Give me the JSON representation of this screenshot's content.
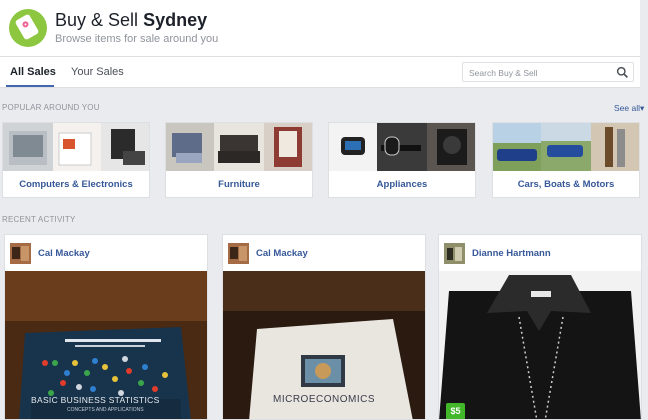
{
  "app": {
    "title_prefix": "Buy & Sell",
    "title_city": "Sydney",
    "subtitle": "Browse items for sale around you"
  },
  "tabs": [
    {
      "label": "All Sales",
      "active": true
    },
    {
      "label": "Your Sales",
      "active": false
    }
  ],
  "search": {
    "placeholder": "Search Buy & Sell",
    "value": ""
  },
  "popular": {
    "heading": "POPULAR AROUND YOU",
    "see_all": "See all",
    "categories": [
      {
        "label": "Computers & Electronics"
      },
      {
        "label": "Furniture"
      },
      {
        "label": "Appliances"
      },
      {
        "label": "Cars, Boats & Motors"
      }
    ]
  },
  "recent": {
    "heading": "RECENT ACTIVITY",
    "posts": [
      {
        "seller": "Cal Mackay",
        "book_title": "BASIC BUSINESS STATISTICS",
        "book_sub": "CONCEPTS AND APPLICATIONS"
      },
      {
        "seller": "Cal Mackay",
        "book_title": "MICROECONOMICS"
      },
      {
        "seller": "Dianne Hartmann",
        "price": "$5"
      }
    ]
  },
  "colors": {
    "accent": "#4267b2",
    "link": "#365899",
    "logo_green": "#8dc63f",
    "price_green": "#42b72a",
    "background": "#e9ebee"
  },
  "icons": [
    "price-tag-icon",
    "search-icon",
    "chevron-down-icon"
  ]
}
